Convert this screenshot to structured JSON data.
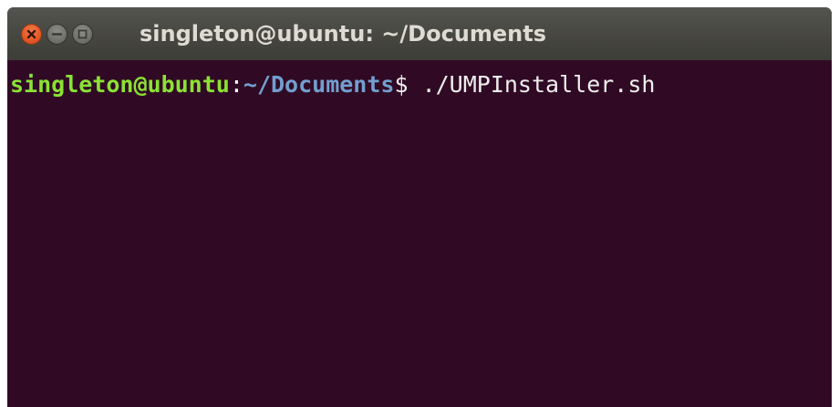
{
  "window": {
    "title": "singleton@ubuntu: ~/Documents",
    "buttons": {
      "close": "close-icon",
      "minimize": "minimize-icon",
      "maximize": "maximize-icon"
    }
  },
  "terminal": {
    "prompt": {
      "user_host": "singleton@ubuntu",
      "separator": ":",
      "path": "~/Documents",
      "symbol": "$ ",
      "command": "./UMPInstaller.sh"
    }
  },
  "colors": {
    "terminal_background": "#300a24",
    "user_host": "#8ae234",
    "path": "#729fcf",
    "text": "#eeeeec",
    "close_button": "#e55a28"
  }
}
